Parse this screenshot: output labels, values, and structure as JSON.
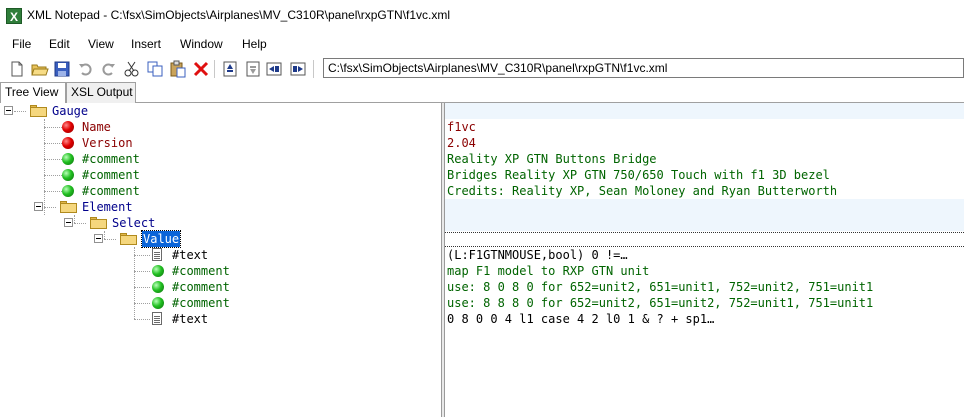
{
  "window": {
    "title": "XML Notepad - C:\\fsx\\SimObjects\\Airplanes\\MV_C310R\\panel\\rxpGTN\\f1vc.xml",
    "app_icon": "X"
  },
  "menu": [
    "File",
    "Edit",
    "View",
    "Insert",
    "Window",
    "Help"
  ],
  "toolbar": {
    "icons": [
      "new-icon",
      "open-icon",
      "save-icon",
      "undo-icon",
      "redo-icon",
      "cut-icon",
      "copy-icon",
      "paste-icon",
      "delete-icon",
      "nudge-up-icon",
      "nudge-down-icon",
      "nudge-left-icon",
      "nudge-right-icon"
    ],
    "address": "C:\\fsx\\SimObjects\\Airplanes\\MV_C310R\\panel\\rxpGTN\\f1vc.xml"
  },
  "tabs": [
    {
      "label": "Tree View",
      "active": true
    },
    {
      "label": "XSL Output",
      "active": false
    }
  ],
  "tree": [
    {
      "label": "Gauge",
      "kind": "element"
    },
    {
      "label": "Name",
      "kind": "attribute"
    },
    {
      "label": "Version",
      "kind": "attribute"
    },
    {
      "label": "#comment",
      "kind": "comment"
    },
    {
      "label": "#comment",
      "kind": "comment"
    },
    {
      "label": "#comment",
      "kind": "comment"
    },
    {
      "label": "Element",
      "kind": "element"
    },
    {
      "label": "Select",
      "kind": "element"
    },
    {
      "label": "Value",
      "kind": "element",
      "selected": true
    },
    {
      "label": "#text",
      "kind": "text"
    },
    {
      "label": "#comment",
      "kind": "comment"
    },
    {
      "label": "#comment",
      "kind": "comment"
    },
    {
      "label": "#comment",
      "kind": "comment"
    },
    {
      "label": "#text",
      "kind": "text"
    }
  ],
  "values": [
    "",
    "f1vc",
    "2.04",
    "Reality XP GTN Buttons Bridge",
    "Bridges Reality XP GTN 750/650 Touch with f1 3D bezel",
    "Credits: Reality XP, Sean Moloney and Ryan Butterworth",
    "",
    "",
    "",
    "(L:F1GTNMOUSE,bool) 0 !=…",
    "map F1 model to RXP GTN unit",
    "use: 8 0 8 0 for 652=unit2, 651=unit1, 752=unit2, 751=unit1",
    "use: 8 8 8 0 for 652=unit2, 651=unit2, 752=unit1, 751=unit1",
    "0 8 0 0   4 l1 case 4 2 l0 1 & ? + sp1…"
  ],
  "colors": {
    "element": "#00008b",
    "attribute": "#8b0000",
    "comment": "#006400",
    "selection": "#0a64d8"
  }
}
